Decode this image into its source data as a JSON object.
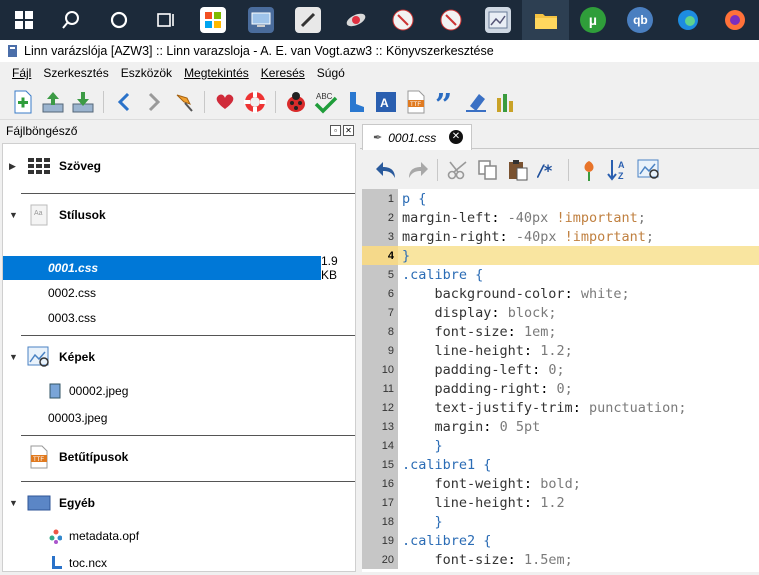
{
  "window_title": "Linn varázslója [AZW3] :: Linn  varazsloja - A. E. van Vogt.azw3 :: Könyvszerkesztése",
  "menu": [
    {
      "label": "Fájl"
    },
    {
      "label": "Szerkesztés"
    },
    {
      "label": "Eszközök"
    },
    {
      "label": "Megtekintés"
    },
    {
      "label": "Keresés"
    },
    {
      "label": "Súgó"
    }
  ],
  "dock": {
    "title": "Fájlböngésző"
  },
  "tree": {
    "categories": {
      "text": "Szöveg",
      "styles": "Stílusok",
      "images": "Képek",
      "fonts": "Betűtípusok",
      "other": "Egyéb"
    },
    "styles_files": [
      {
        "name": "0001.css",
        "size": "1.9 KB"
      },
      {
        "name": "0002.css"
      },
      {
        "name": "0003.css"
      }
    ],
    "image_files": [
      {
        "name": "00002.jpeg"
      },
      {
        "name": "00003.jpeg"
      }
    ],
    "other_files": [
      {
        "name": "metadata.opf"
      },
      {
        "name": "toc.ncx"
      }
    ]
  },
  "editor": {
    "tab_label": "0001.css",
    "current_line": 4,
    "lines": [
      "p {",
      "margin-left: -40px !important;",
      "margin-right: -40px !important;",
      "}",
      ".calibre {",
      "    background-color: white;",
      "    display: block;",
      "    font-size: 1em;",
      "    line-height: 1.2;",
      "    padding-left: 0;",
      "    padding-right: 0;",
      "    text-justify-trim: punctuation;",
      "    margin: 0 5pt",
      "    }",
      ".calibre1 {",
      "    font-weight: bold;",
      "    line-height: 1.2",
      "    }",
      ".calibre2 {",
      "    font-size: 1.5em;"
    ]
  },
  "colors": {
    "selection": "#0078d7",
    "current_line": "#f9e5a0",
    "gutter": "#c6c6c6"
  }
}
